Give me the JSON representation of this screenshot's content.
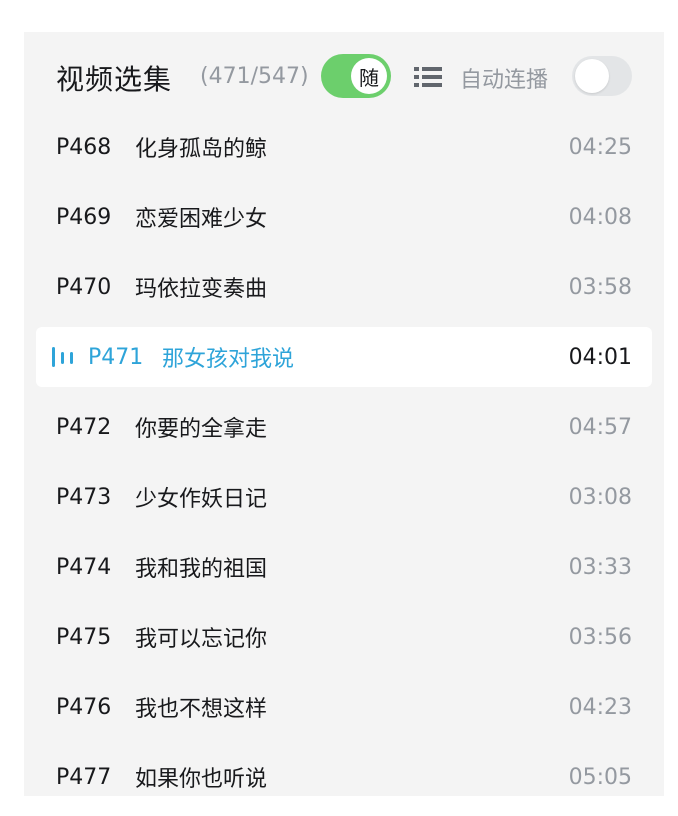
{
  "header": {
    "title": "视频选集",
    "count": "(471/547)",
    "random_toggle": {
      "label": "随",
      "on": true,
      "color": "#6ccf6c"
    },
    "autoplay_label": "自动连播",
    "autoplay_toggle": {
      "on": false
    }
  },
  "colors": {
    "accent": "#2ea4d9",
    "muted": "#9499a0",
    "panel_bg": "#f4f4f4"
  },
  "episodes": [
    {
      "num": "P468",
      "name": "化身孤岛的鲸",
      "duration": "04:25",
      "active": false
    },
    {
      "num": "P469",
      "name": "恋爱困难少女",
      "duration": "04:08",
      "active": false
    },
    {
      "num": "P470",
      "name": "玛依拉变奏曲",
      "duration": "03:58",
      "active": false
    },
    {
      "num": "P471",
      "name": "那女孩对我说",
      "duration": "04:01",
      "active": true,
      "icon": "playing-bars-icon"
    },
    {
      "num": "P472",
      "name": "你要的全拿走",
      "duration": "04:57",
      "active": false
    },
    {
      "num": "P473",
      "name": "少女作妖日记",
      "duration": "03:08",
      "active": false
    },
    {
      "num": "P474",
      "name": "我和我的祖国",
      "duration": "03:33",
      "active": false
    },
    {
      "num": "P475",
      "name": "我可以忘记你",
      "duration": "03:56",
      "active": false
    },
    {
      "num": "P476",
      "name": "我也不想这样",
      "duration": "04:23",
      "active": false
    },
    {
      "num": "P477",
      "name": "如果你也听说",
      "duration": "05:05",
      "active": false
    }
  ]
}
